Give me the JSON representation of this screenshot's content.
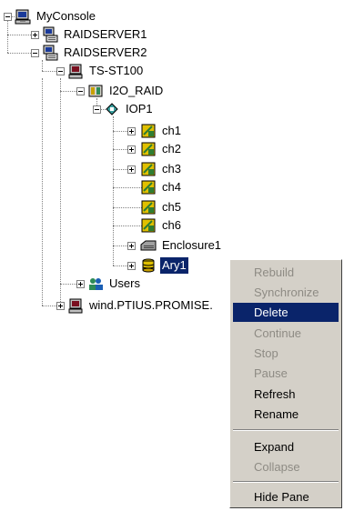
{
  "tree": {
    "root": "MyConsole",
    "server1": "RAIDSERVER1",
    "server2": "RAIDSERVER2",
    "host": "TS-ST100",
    "i2o": "I2O_RAID",
    "iop": "IOP1",
    "channels": [
      "ch1",
      "ch2",
      "ch3",
      "ch4",
      "ch5",
      "ch6"
    ],
    "enclosure": "Enclosure1",
    "array": "Ary1",
    "users": "Users",
    "wind": "wind.PTIUS.PROMISE."
  },
  "context_menu": {
    "rebuild": "Rebuild",
    "synchronize": "Synchronize",
    "delete": "Delete",
    "continue": "Continue",
    "stop": "Stop",
    "pause": "Pause",
    "refresh": "Refresh",
    "rename": "Rename",
    "expand": "Expand",
    "collapse": "Collapse",
    "hide_pane": "Hide Pane"
  },
  "colors": {
    "selection": "#0a246a",
    "menu_background": "#d4d0c8",
    "disabled_text": "#8e8b84"
  }
}
